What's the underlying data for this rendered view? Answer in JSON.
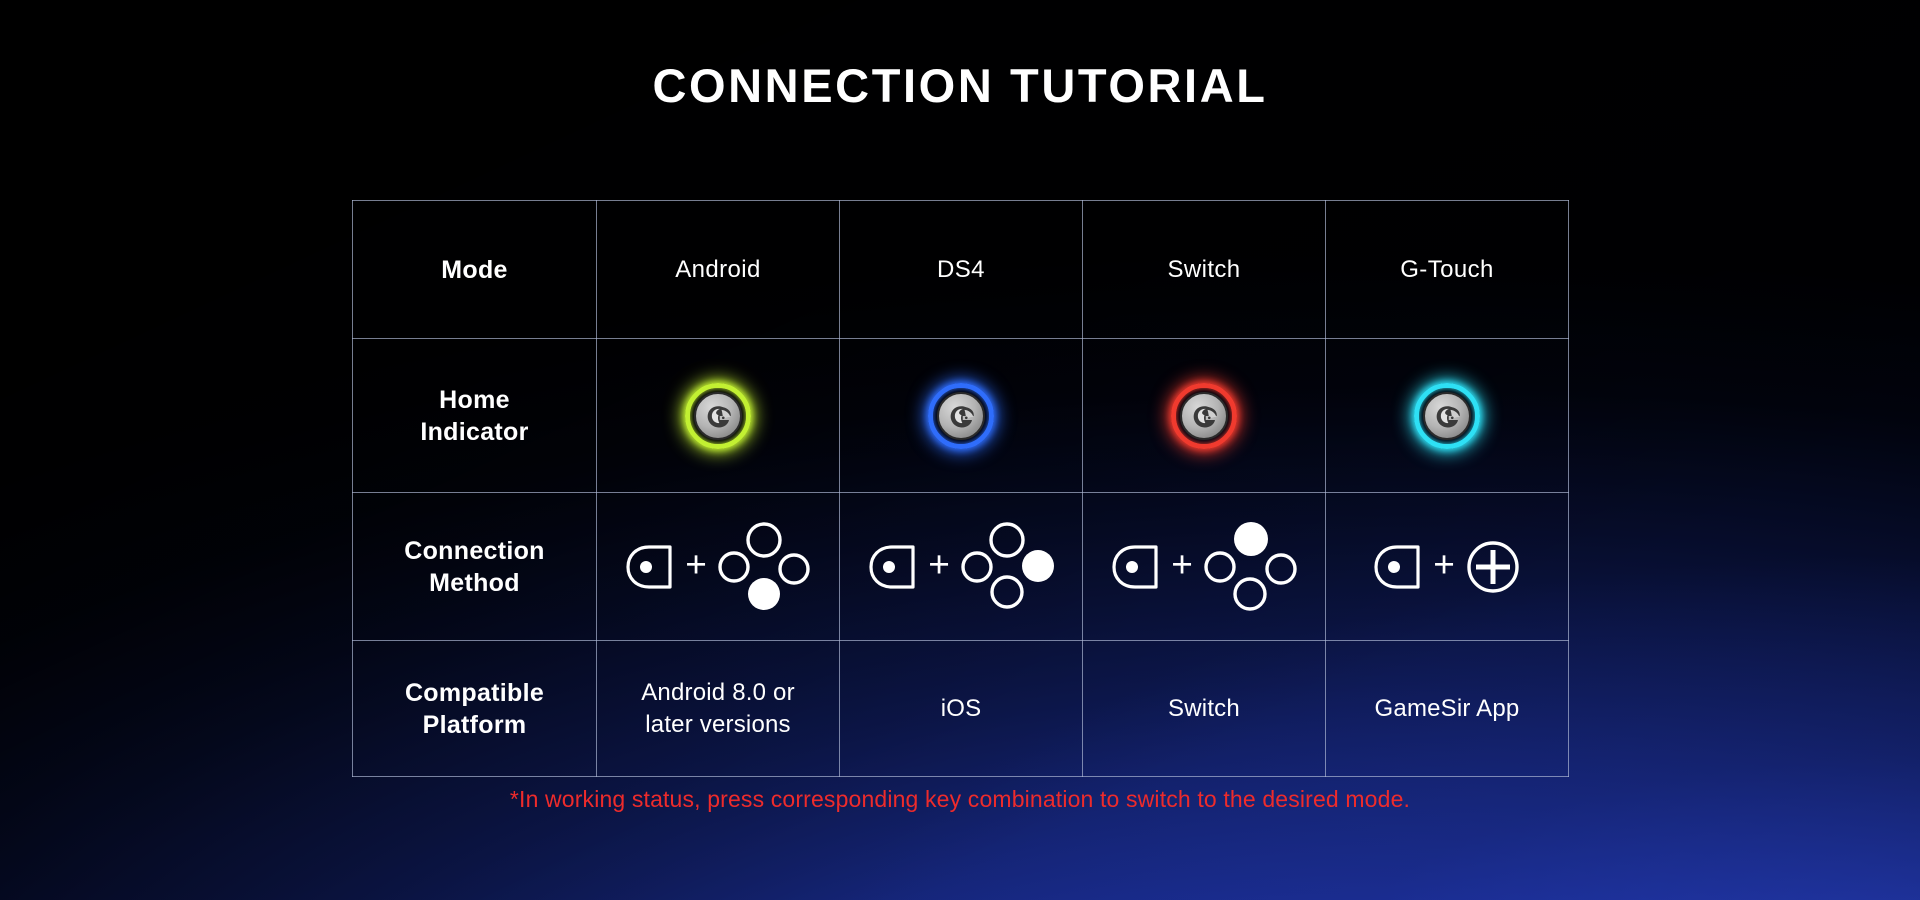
{
  "page": {
    "title": "CONNECTION TUTORIAL",
    "footnote": "*In working status, press corresponding key combination to switch to the desired mode."
  },
  "table": {
    "row_labels": {
      "mode": "Mode",
      "home_indicator": "Home\nIndicator",
      "home_indicator_line1": "Home",
      "home_indicator_line2": "Indicator",
      "connection_method_line1": "Connection",
      "connection_method_line2": "Method",
      "compatible_platform_line1": "Compatible",
      "compatible_platform_line2": "Platform"
    },
    "columns": [
      {
        "key": "android",
        "header": "Android",
        "indicator_color": "#c2f032",
        "indicator_name": "gamesir-logo-green",
        "combo": {
          "left_icon": "home-button-icon",
          "operator": "+",
          "right_icon": "face-buttons-diamond-icon",
          "highlighted_button": "bottom"
        },
        "platform_line1": "Android  8.0 or",
        "platform_line2": "later versions"
      },
      {
        "key": "ds4",
        "header": "DS4",
        "indicator_color": "#2f6dfb",
        "indicator_name": "gamesir-logo-blue",
        "combo": {
          "left_icon": "home-button-icon",
          "operator": "+",
          "right_icon": "face-buttons-diamond-icon",
          "highlighted_button": "right"
        },
        "platform_line1": "iOS",
        "platform_line2": ""
      },
      {
        "key": "switch",
        "header": "Switch",
        "indicator_color": "#f03a2e",
        "indicator_name": "gamesir-logo-red",
        "combo": {
          "left_icon": "home-button-icon",
          "operator": "+",
          "right_icon": "face-buttons-diamond-icon",
          "highlighted_button": "top"
        },
        "platform_line1": "Switch",
        "platform_line2": ""
      },
      {
        "key": "g-touch",
        "header": "G-Touch",
        "indicator_color": "#2ee0f5",
        "indicator_name": "gamesir-logo-cyan",
        "combo": {
          "left_icon": "home-button-icon",
          "operator": "+",
          "right_icon": "dpad-plus-circle-icon",
          "highlighted_button": "none"
        },
        "platform_line1": "GameSir App",
        "platform_line2": ""
      }
    ]
  },
  "colors": {
    "background_top": "#000005",
    "background_bottom": "#1e33ad",
    "grid_line": "#b0bad6",
    "text": "#ffffff",
    "footnote": "#ee2b2b"
  }
}
